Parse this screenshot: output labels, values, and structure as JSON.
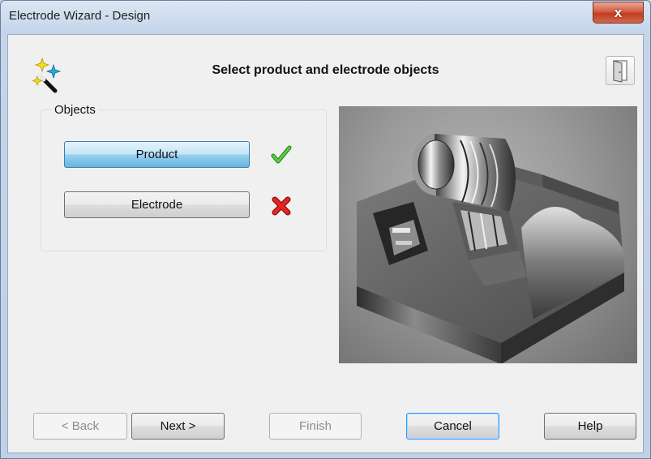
{
  "window": {
    "title": "Electrode Wizard - Design",
    "close_glyph": "x"
  },
  "header": {
    "title": "Select product and electrode objects",
    "icon": "wizard-magic-wand-icon",
    "exit_icon": "exit-door-icon"
  },
  "objects": {
    "legend": "Objects",
    "items": [
      {
        "label": "Product",
        "status": "selected",
        "status_icon": "checkmark-icon",
        "status_color": "#3fb32b"
      },
      {
        "label": "Electrode",
        "status": "not-selected",
        "status_icon": "red-x-icon",
        "status_color": "#e11b1b"
      }
    ]
  },
  "preview": {
    "subject": "3d-electrode-product-render"
  },
  "footer": {
    "back": "< Back",
    "next": "Next >",
    "finish": "Finish",
    "cancel": "Cancel",
    "help": "Help"
  }
}
